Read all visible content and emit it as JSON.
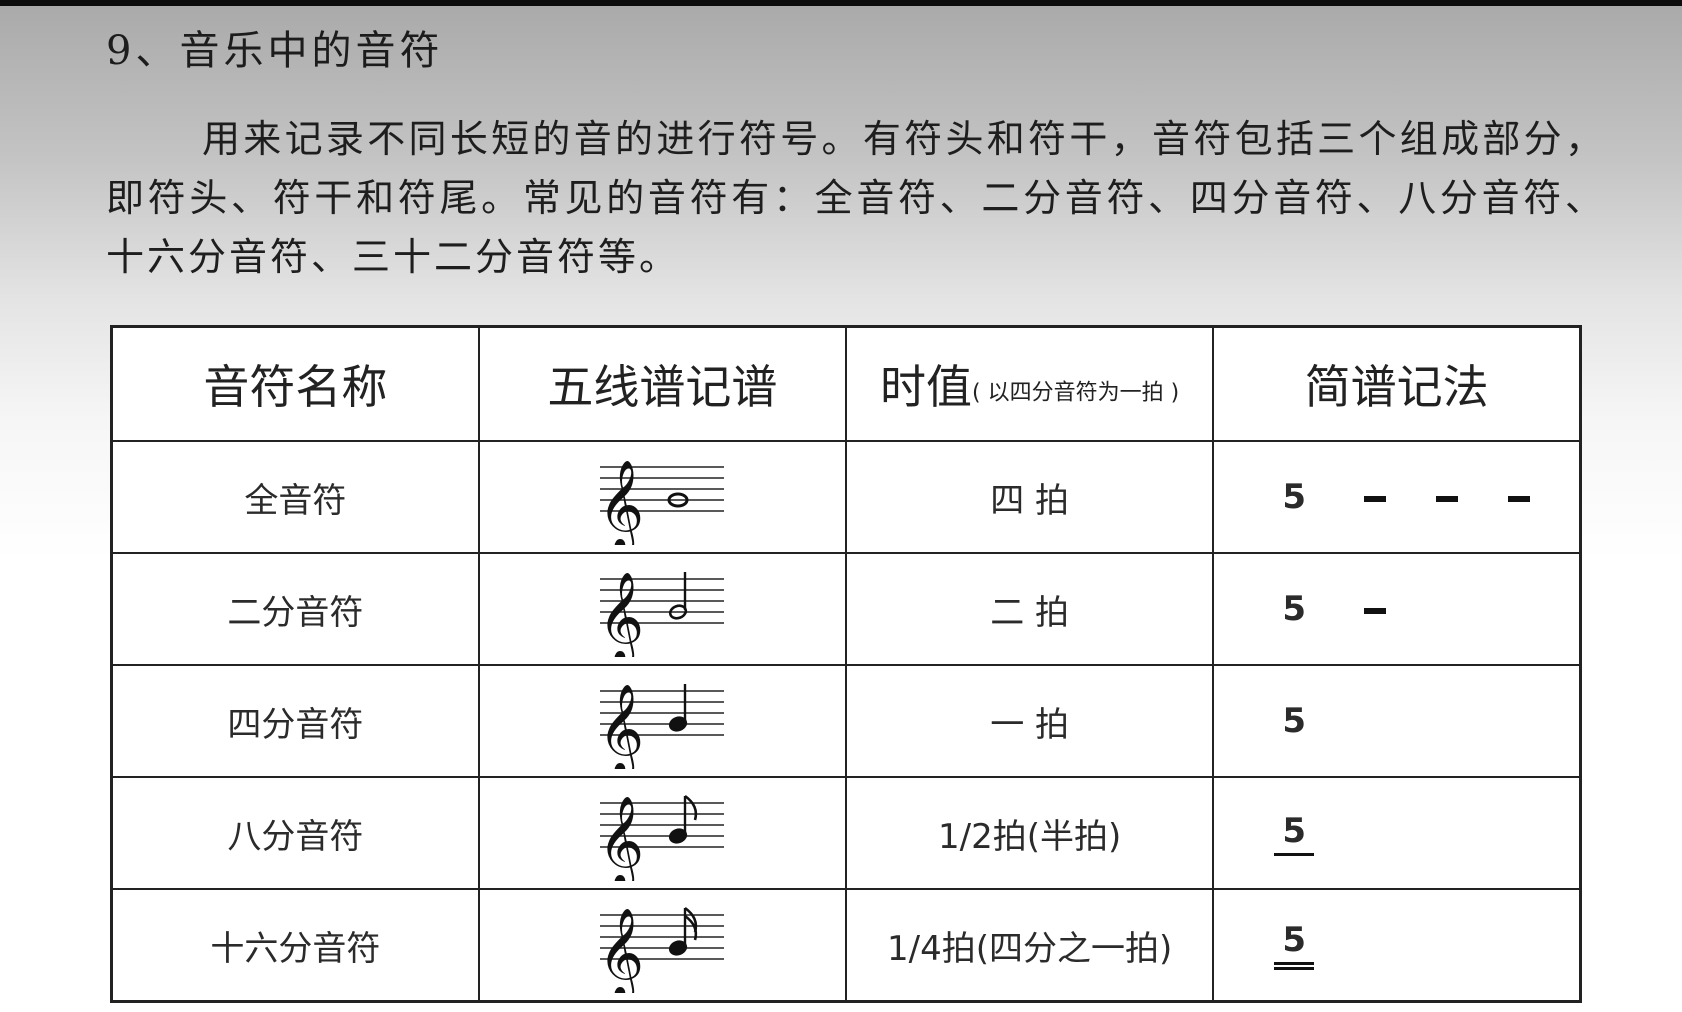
{
  "section": {
    "heading": "9、音乐中的音符",
    "paragraph": "用来记录不同长短的音的进行符号。有符头和符干，音符包括三个组成部分，即符头、符干和符尾。常见的音符有：全音符、二分音符、四分音符、八分音符、十六分音符、三十二分音符等。"
  },
  "table": {
    "headers": {
      "name": "音符名称",
      "staff": "五线谱记谱",
      "duration": "时值",
      "duration_hint": "( 以四分音符为一拍 )",
      "jianpu": "简谱记法"
    },
    "rows": [
      {
        "name": "全音符",
        "staff_icon": "whole-note-icon",
        "duration": "四 拍",
        "jianpu_digit": "5",
        "dashes": 3,
        "underlines": 0
      },
      {
        "name": "二分音符",
        "staff_icon": "half-note-icon",
        "duration": "二 拍",
        "jianpu_digit": "5",
        "dashes": 1,
        "underlines": 0
      },
      {
        "name": "四分音符",
        "staff_icon": "quarter-note-icon",
        "duration": "一 拍",
        "jianpu_digit": "5",
        "dashes": 0,
        "underlines": 0
      },
      {
        "name": "八分音符",
        "staff_icon": "eighth-note-icon",
        "duration": "1/2拍(半拍)",
        "jianpu_digit": "5",
        "dashes": 0,
        "underlines": 1
      },
      {
        "name": "十六分音符",
        "staff_icon": "sixteenth-note-icon",
        "duration": "1/4拍(四分之一拍)",
        "jianpu_digit": "5",
        "dashes": 0,
        "underlines": 2
      }
    ]
  }
}
